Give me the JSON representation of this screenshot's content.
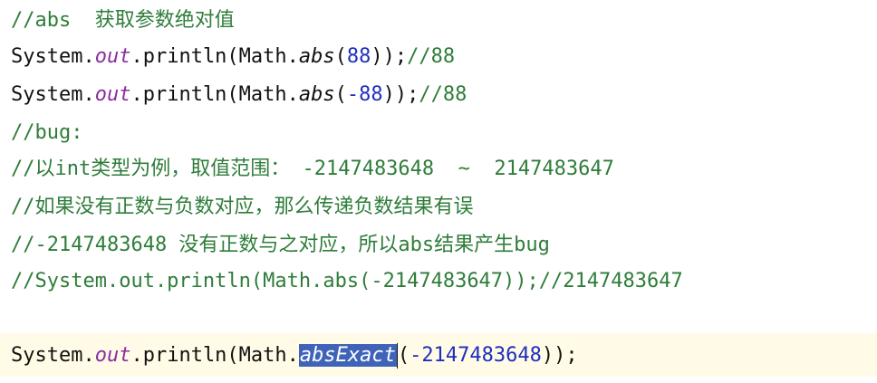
{
  "colors": {
    "comment": "#2f7d3a",
    "static_field": "#8a2ea0",
    "number": "#1d2fbf",
    "selection": "#3f63b8",
    "current_line": "#fffbe6"
  },
  "lines": {
    "l1_comment": "//abs  获取参数绝对值",
    "l2": {
      "prefix": "System.",
      "field": "out",
      "mid": ".println(Math.",
      "method": "abs",
      "open": "(",
      "num": "88",
      "close": "));",
      "comment": "//88"
    },
    "l3": {
      "prefix": "System.",
      "field": "out",
      "mid": ".println(Math.",
      "method": "abs",
      "open": "(",
      "num": "-88",
      "close": "));",
      "comment": "//88"
    },
    "l4_comment": "//bug:",
    "l5_comment": "//以int类型为例，取值范围： -2147483648  ~  2147483647",
    "l6_comment": "//如果没有正数与负数对应，那么传递负数结果有误",
    "l7_comment": "//-2147483648 没有正数与之对应，所以abs结果产生bug",
    "l8_comment": "//System.out.println(Math.abs(-2147483647));//2147483647",
    "l10": {
      "prefix": "System.",
      "field": "out",
      "mid": ".println(Math.",
      "method_selected": "absExact",
      "open": "(",
      "num": "-2147483648",
      "close": "));"
    }
  }
}
